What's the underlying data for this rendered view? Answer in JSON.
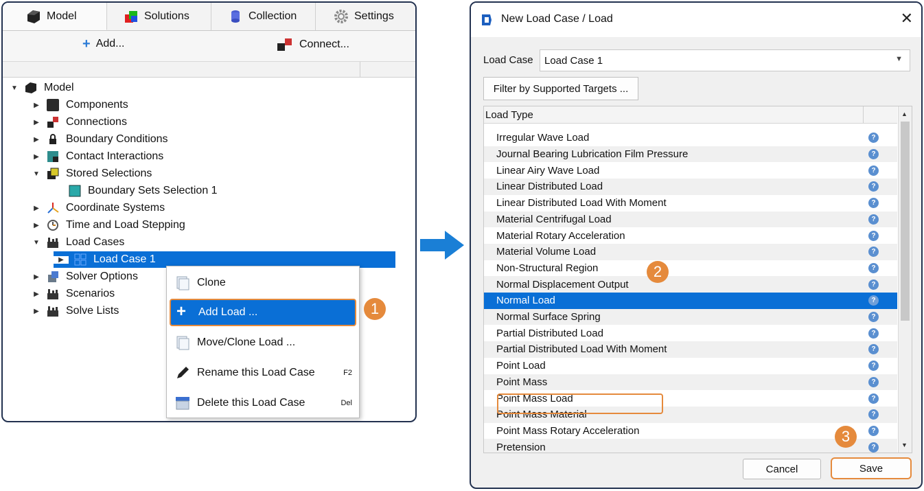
{
  "left": {
    "tabs": [
      {
        "label": "Model",
        "icon": "model-icon"
      },
      {
        "label": "Solutions",
        "icon": "solutions-icon"
      },
      {
        "label": "Collection",
        "icon": "collection-icon"
      },
      {
        "label": "Settings",
        "icon": "gear-icon"
      }
    ],
    "toolbar": {
      "add_label": "Add...",
      "connect_label": "Connect..."
    },
    "tree": {
      "root": "Model",
      "items": [
        {
          "label": "Components"
        },
        {
          "label": "Connections"
        },
        {
          "label": "Boundary Conditions"
        },
        {
          "label": "Contact Interactions"
        },
        {
          "label": "Stored Selections"
        },
        {
          "label": "Boundary Sets Selection 1"
        },
        {
          "label": "Coordinate Systems"
        },
        {
          "label": "Time and Load Stepping"
        },
        {
          "label": "Load Cases"
        },
        {
          "label": "Load Case 1"
        },
        {
          "label": "Solver Options"
        },
        {
          "label": "Scenarios"
        },
        {
          "label": "Solve Lists"
        }
      ]
    },
    "context_menu": [
      {
        "label": "Clone",
        "shortcut": ""
      },
      {
        "label": "Add Load ...",
        "shortcut": ""
      },
      {
        "label": "Move/Clone Load ...",
        "shortcut": ""
      },
      {
        "label": "Rename this Load Case",
        "shortcut": "F2"
      },
      {
        "label": "Delete this Load Case",
        "shortcut": "Del"
      }
    ]
  },
  "steps": [
    "1",
    "2",
    "3"
  ],
  "dialog": {
    "title": "New Load Case / Load",
    "close": "✕",
    "load_case_label": "Load Case",
    "load_case_value": "Load Case 1",
    "filter_button": "Filter by Supported Targets ...",
    "list_header": "Load Type",
    "help_glyph": "?",
    "items": [
      "Irregular Wave Load",
      "Journal Bearing Lubrication Film Pressure",
      "Linear Airy Wave Load",
      "Linear Distributed Load",
      "Linear Distributed Load With Moment",
      "Material Centrifugal Load",
      "Material Rotary Acceleration",
      "Material Volume Load",
      "Non-Structural Region",
      "Normal Displacement Output",
      "Normal Load",
      "Normal Surface Spring",
      "Partial Distributed Load",
      "Partial Distributed Load With Moment",
      "Point Load",
      "Point Mass",
      "Point Mass Load",
      "Point Mass Material",
      "Point Mass Rotary Acceleration",
      "Pretension"
    ],
    "selected_item": "Normal Load",
    "cancel": "Cancel",
    "save": "Save"
  },
  "colors": {
    "accent": "#0a6fd6",
    "highlight": "#e58a3c",
    "border": "#22314f"
  }
}
